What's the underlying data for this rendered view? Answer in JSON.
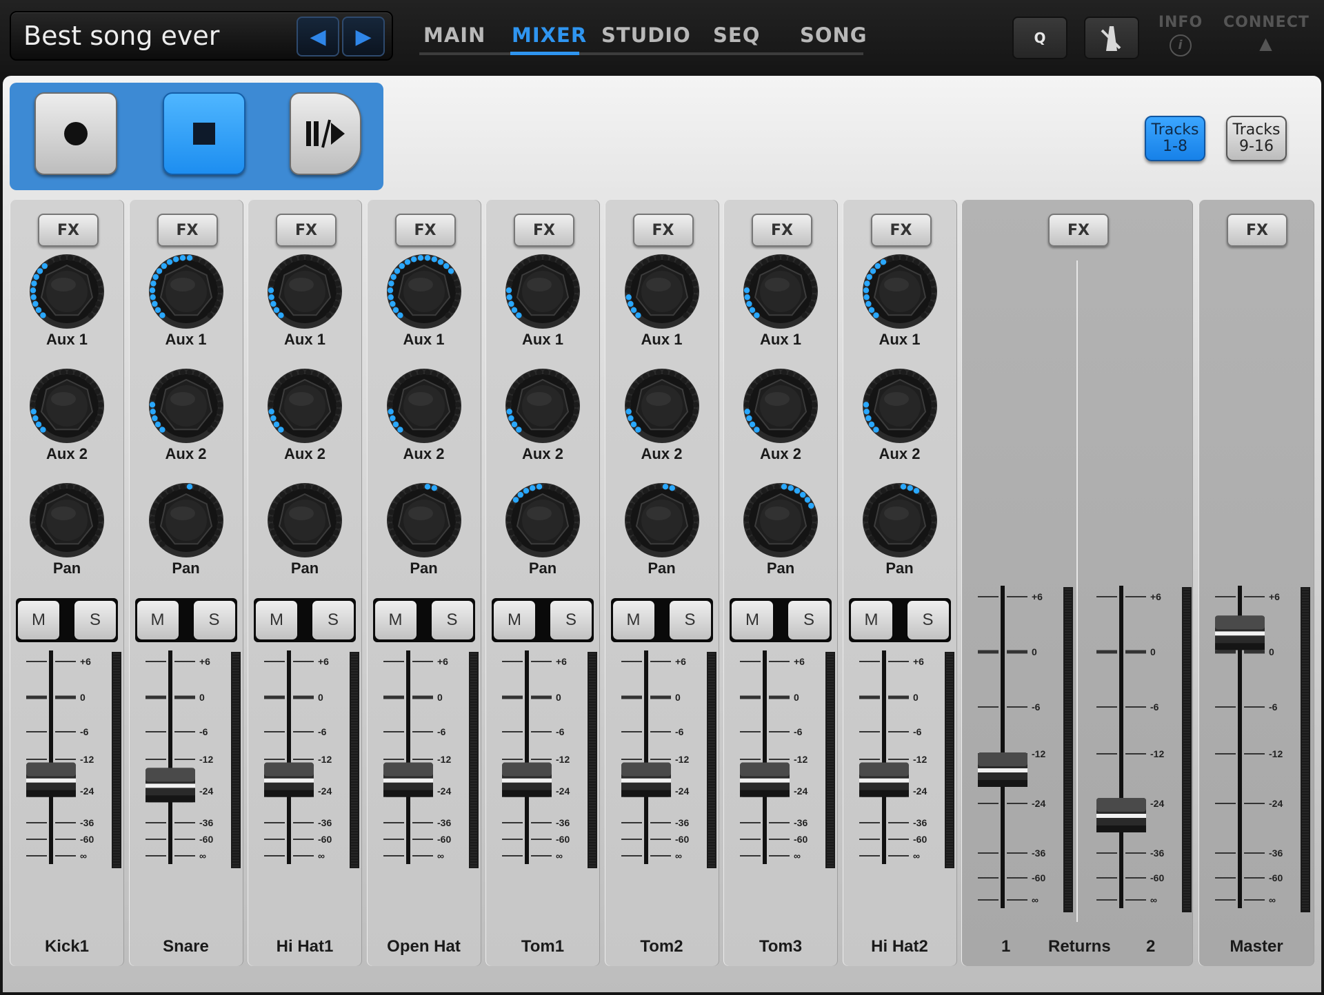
{
  "song": {
    "title": "Best song ever",
    "prev_label": "◀",
    "next_label": "▶"
  },
  "nav": {
    "tabs": [
      {
        "label": "MAIN",
        "active": false
      },
      {
        "label": "MIXER",
        "active": true
      },
      {
        "label": "STUDIO",
        "active": false
      },
      {
        "label": "SEQ",
        "active": false
      },
      {
        "label": "SONG",
        "active": false
      }
    ]
  },
  "topright": {
    "q_label": "Q",
    "info_label": "INFO",
    "info_icon": "i",
    "connect_label": "CONNECT",
    "connect_icon": "▲"
  },
  "tracks_buttons": [
    {
      "label_line1": "Tracks",
      "label_line2": "1-8",
      "active": true
    },
    {
      "label_line1": "Tracks",
      "label_line2": "9-16",
      "active": false
    }
  ],
  "colors": {
    "accent": "#2f95f0",
    "led_on": "#2aa8ff",
    "led_off": "#1c1c1c",
    "transport_bg": "#3d8ad4"
  },
  "labels": {
    "fx": "FX",
    "aux1": "Aux 1",
    "aux2": "Aux 2",
    "pan": "Pan",
    "mute": "M",
    "solo": "S",
    "returns": "Returns",
    "return1": "1",
    "return2": "2",
    "master": "Master"
  },
  "fader_scale": [
    "+6",
    "0",
    "-6",
    "-12",
    "-24",
    "-36",
    "-60",
    "∞"
  ],
  "channels": [
    {
      "name": "Kick1",
      "aux1": 0.35,
      "aux2": 0.15,
      "pan": 0.5,
      "fader_db": -20
    },
    {
      "name": "Snare",
      "aux1": 0.55,
      "aux2": 0.2,
      "pan": 0.55,
      "fader_db": -22
    },
    {
      "name": "Hi Hat1",
      "aux1": 0.2,
      "aux2": 0.15,
      "pan": 0.5,
      "fader_db": -20
    },
    {
      "name": "Open Hat",
      "aux1": 0.7,
      "aux2": 0.15,
      "pan": 0.6,
      "fader_db": -20
    },
    {
      "name": "Tom1",
      "aux1": 0.2,
      "aux2": 0.15,
      "pan": 0.3,
      "fader_db": -20
    },
    {
      "name": "Tom2",
      "aux1": 0.15,
      "aux2": 0.15,
      "pan": 0.6,
      "fader_db": -20
    },
    {
      "name": "Tom3",
      "aux1": 0.2,
      "aux2": 0.15,
      "pan": 0.75,
      "fader_db": -20
    },
    {
      "name": "Hi Hat2",
      "aux1": 0.4,
      "aux2": 0.2,
      "pan": 0.65,
      "fader_db": -20
    }
  ],
  "returns": [
    {
      "fader_db": -16
    },
    {
      "fader_db": -27
    }
  ],
  "master": {
    "fader_db": 2
  }
}
